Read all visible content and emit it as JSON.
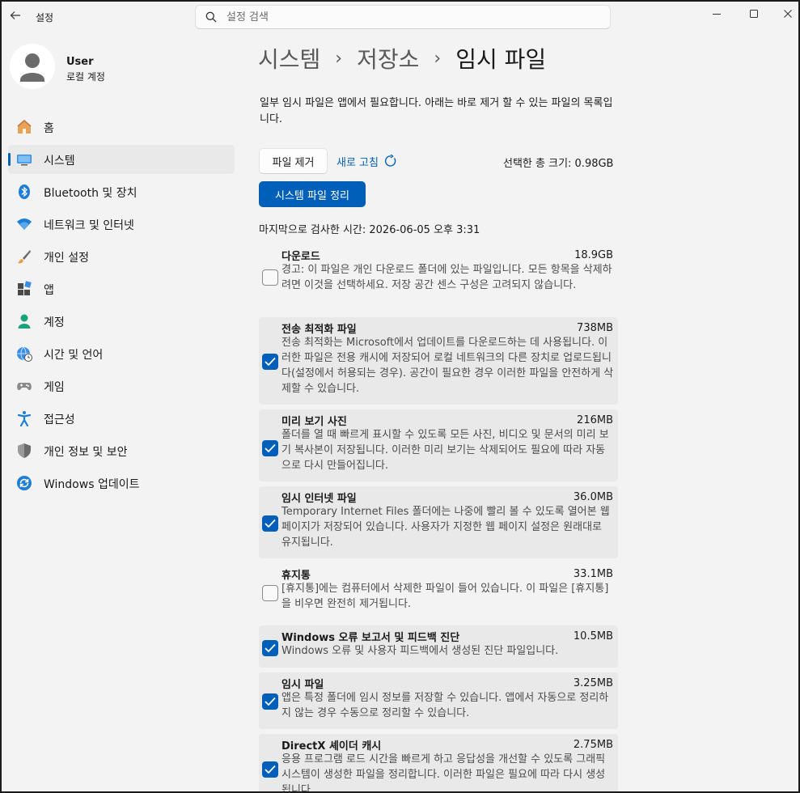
{
  "app": {
    "title": "설정",
    "search_placeholder": "설정 검색"
  },
  "user": {
    "name": "User",
    "account": "로컬 계정"
  },
  "sidebar": {
    "items": [
      {
        "label": "홈",
        "icon": "home-icon"
      },
      {
        "label": "시스템",
        "icon": "system-icon",
        "active": true
      },
      {
        "label": "Bluetooth 및 장치",
        "icon": "bluetooth-icon"
      },
      {
        "label": "네트워크 및 인터넷",
        "icon": "wifi-icon"
      },
      {
        "label": "개인 설정",
        "icon": "brush-icon"
      },
      {
        "label": "앱",
        "icon": "apps-icon"
      },
      {
        "label": "계정",
        "icon": "account-icon"
      },
      {
        "label": "시간 및 언어",
        "icon": "globe-clock-icon"
      },
      {
        "label": "게임",
        "icon": "gamepad-icon"
      },
      {
        "label": "접근성",
        "icon": "accessibility-icon"
      },
      {
        "label": "개인 정보 및 보안",
        "icon": "shield-icon"
      },
      {
        "label": "Windows 업데이트",
        "icon": "update-icon"
      }
    ]
  },
  "breadcrumb": {
    "items": [
      "시스템",
      "저장소",
      "임시 파일"
    ]
  },
  "main": {
    "description": "일부 임시 파일은 앱에서 필요합니다. 아래는 바로 제거 할 수 있는 파일의 목록입니다.",
    "delete_button": "파일 제거",
    "refresh_link": "새로 고침",
    "total_size": "선택한 총 크기: 0.98GB",
    "system_clean_button": "시스템 파일 정리",
    "last_scan": "마지막으로 검사한 시간: 2026-06-05 오후 3:31"
  },
  "items": [
    {
      "title": "다운로드",
      "size": "18.9GB",
      "checked": false,
      "desc": "경고: 이 파일은 개인 다운로드 폴더에 있는 파일입니다. 모든 항목을 삭제하려면 이것을 선택하세요. 저장 공간 센스 구성은 고려되지 않습니다."
    },
    {
      "title": "전송 최적화 파일",
      "size": "738MB",
      "checked": true,
      "desc": "전송 최적화는 Microsoft에서 업데이트를 다운로드하는 데 사용됩니다. 이러한 파일은 전용 캐시에 저장되어 로컬 네트워크의 다른 장치로 업로드됩니다(설정에서 허용되는 경우). 공간이 필요한 경우 이러한 파일을 안전하게 삭제할 수 있습니다."
    },
    {
      "title": "미리 보기 사진",
      "size": "216MB",
      "checked": true,
      "desc": "폴더를 열 때 빠르게 표시할 수 있도록 모든 사진, 비디오 및 문서의 미리 보기 복사본이 저장됩니다. 이러한 미리 보기는 삭제되어도 필요에 따라 자동으로 다시 만들어집니다."
    },
    {
      "title": "임시 인터넷 파일",
      "size": "36.0MB",
      "checked": true,
      "desc": "Temporary Internet Files 폴더에는 나중에 빨리 볼 수 있도록 열어본 웹 페이지가 저장되어 있습니다. 사용자가 지정한 웹 페이지 설정은 원래대로 유지됩니다."
    },
    {
      "title": "휴지통",
      "size": "33.1MB",
      "checked": false,
      "desc": "[휴지통]에는 컴퓨터에서 삭제한 파일이 들어 있습니다. 이 파일은 [휴지통]을 비우면 완전히 제거됩니다."
    },
    {
      "title": "Windows 오류 보고서 및 피드백 진단",
      "size": "10.5MB",
      "checked": true,
      "desc": "Windows 오류 및 사용자 피드백에서 생성된 진단 파일입니다."
    },
    {
      "title": "임시 파일",
      "size": "3.25MB",
      "checked": true,
      "desc": "앱은 특정 폴더에 임시 정보를 저장할 수 있습니다. 앱에서 자동으로 정리하지 않는 경우 수동으로 정리할 수 있습니다."
    },
    {
      "title": "DirectX 셰이더 캐시",
      "size": "2.75MB",
      "checked": true,
      "desc": "응용 프로그램 로드 시간을 빠르게 하고 응답성을 개선할 수 있도록 그래픽 시스템이 생성한 파일을 정리합니다. 이러한 파일은 필요에 따라 다시 생성됩니다."
    }
  ],
  "colors": {
    "accent": "#005fb8",
    "window_bg": "#f3f3f3",
    "selected_row_bg": "#e9e9e9"
  }
}
